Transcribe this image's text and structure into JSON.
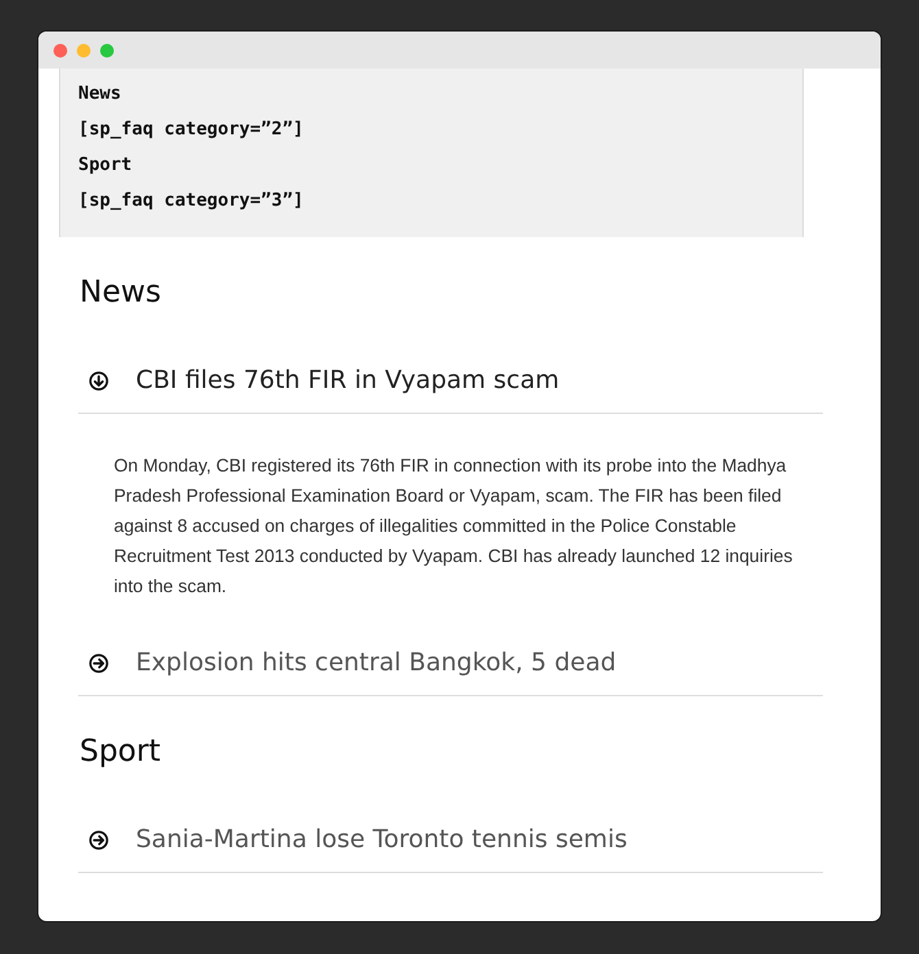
{
  "code_block": {
    "lines": [
      "News",
      "[sp_faq category=”2”]",
      "Sport",
      "[sp_faq category=”3”]"
    ]
  },
  "sections": [
    {
      "heading": "News",
      "items": [
        {
          "question": "CBI files 76th FIR in Vyapam scam",
          "expanded": true,
          "answer": "On Monday, CBI registered its 76th FIR in connection with its probe into the Madhya Pradesh Professional Examination Board or Vyapam, scam. The FIR has been filed against 8 accused on charges of illegalities committed in the Police Constable Recruitment Test 2013 conducted by Vyapam. CBI has already launched 12 inquiries into the scam."
        },
        {
          "question": "Explosion hits central Bangkok, 5 dead",
          "expanded": false
        }
      ]
    },
    {
      "heading": "Sport",
      "items": [
        {
          "question": "Sania-Martina lose Toronto tennis semis",
          "expanded": false
        }
      ]
    }
  ]
}
